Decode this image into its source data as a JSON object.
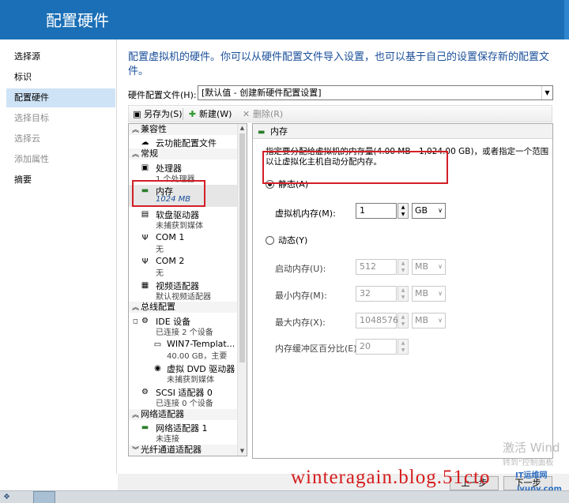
{
  "window": {
    "title": "配置硬件"
  },
  "nav": {
    "items": [
      {
        "label": "选择源",
        "state": "normal"
      },
      {
        "label": "标识",
        "state": "normal"
      },
      {
        "label": "配置硬件",
        "state": "selected"
      },
      {
        "label": "选择目标",
        "state": "disabled"
      },
      {
        "label": "选择云",
        "state": "disabled"
      },
      {
        "label": "添加属性",
        "state": "disabled"
      },
      {
        "label": "摘要",
        "state": "normal"
      }
    ]
  },
  "intro": "配置虚拟机的硬件。你可以从硬件配置文件导入设置，也可以基于自己的设置保存新的配置文件。",
  "profile": {
    "label": "硬件配置文件(H):",
    "value": "[默认值 - 创建新硬件配置设置]"
  },
  "toolbar": {
    "save_as": "另存为(S)",
    "new": "新建(W)",
    "delete": "删除(R)"
  },
  "tree": {
    "sections": {
      "compat": "兼容性",
      "general": "常规",
      "bus": "总线配置",
      "network": "网络适配器",
      "fibre": "光纤通道适配器"
    },
    "nodes": {
      "cloud": {
        "label": "云功能配置文件",
        "sub": ""
      },
      "cpu": {
        "label": "处理器",
        "sub": "1 个处理器"
      },
      "memory": {
        "label": "内存",
        "sub": "1024 MB"
      },
      "floppy": {
        "label": "软盘驱动器",
        "sub": "未捕获到媒体"
      },
      "com1": {
        "label": "COM 1",
        "sub": "无"
      },
      "com2": {
        "label": "COM 2",
        "sub": "无"
      },
      "video": {
        "label": "视频适配器",
        "sub": "默认视频适配器"
      },
      "ide": {
        "label": "IDE 设备",
        "sub": "已连接 2 个设备"
      },
      "disk": {
        "label": "WIN7-Templat...",
        "sub": "40.00 GB，主要"
      },
      "dvd": {
        "label": "虚拟 DVD 驱动器",
        "sub": "未捕获到媒体"
      },
      "scsi": {
        "label": "SCSI 适配器 0",
        "sub": "已连接 0 个设备"
      },
      "nic": {
        "label": "网络适配器 1",
        "sub": "未连接"
      }
    }
  },
  "memory_panel": {
    "header": "内存",
    "description": "指定要分配给虚拟机的内存量(4.00 MB - 1,024.00 GB)，或者指定一个范围以让虚拟化主机自动分配内存。",
    "static_label": "静态(A)",
    "static_selected": true,
    "vm_memory_label": "虚拟机内存(M):",
    "vm_memory_value": "1",
    "vm_memory_unit": "GB",
    "dynamic_label": "动态(Y)",
    "startup_label": "启动内存(U):",
    "startup_value": "512",
    "startup_unit": "MB",
    "min_label": "最小内存(M):",
    "min_value": "32",
    "min_unit": "MB",
    "max_label": "最大内存(X):",
    "max_value": "1048576",
    "max_unit": "MB",
    "buffer_label": "内存缓冲区百分比(E):",
    "buffer_value": "20"
  },
  "footer": {
    "prev_button": "上一步",
    "next_button": "下一步"
  },
  "overlay": {
    "watermark": "winteragain.blog.51cto",
    "activate": "激活 Wind",
    "activate_sub": "转到\"控制面板",
    "brand": "IT运维网",
    "brand_url": "iyunv.com"
  },
  "colors": {
    "accent": "#1b6fb6",
    "highlight_box": "#d31f26",
    "intro_text": "#1a4f99"
  }
}
